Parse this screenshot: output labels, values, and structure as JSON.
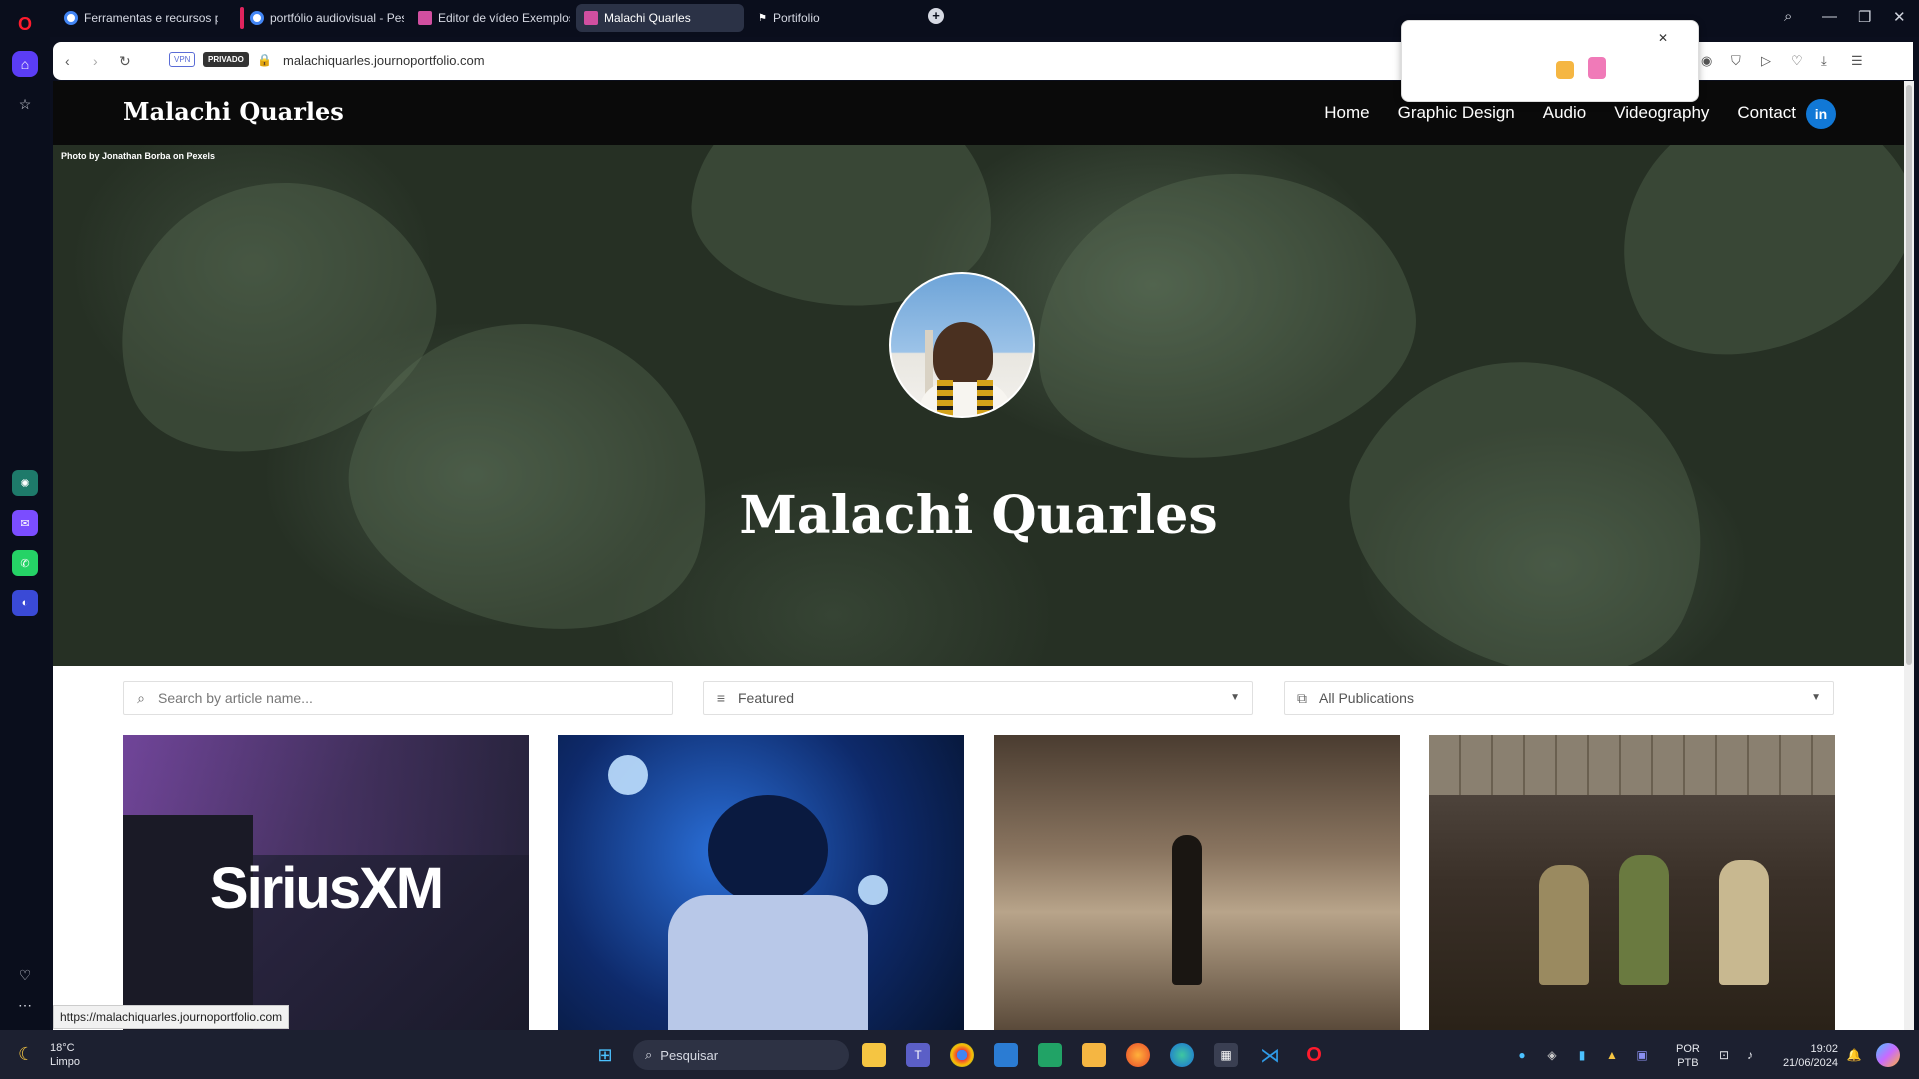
{
  "tabs": [
    {
      "label": "Ferramentas e recursos pa",
      "color": "#4285f4"
    },
    {
      "label": "portfólio audiovisual - Pes",
      "color": "#4285f4"
    },
    {
      "label": "Editor de vídeo Exemplos",
      "color": "#d14fa0"
    },
    {
      "label": "Malachi Quarles",
      "color": "#d14fa0"
    },
    {
      "label": "Portifolio",
      "color": "#ffffff"
    }
  ],
  "address": {
    "vpn": "VPN",
    "private": "PRIVADO",
    "url": "malachiquarles.journoportfolio.com"
  },
  "site": {
    "brand": "Malachi Quarles",
    "nav": [
      "Home",
      "Graphic Design",
      "Audio",
      "Videography",
      "Contact"
    ],
    "linkedin": "in",
    "photo_credit": "Photo by Jonathan Borba on Pexels",
    "hero_title": "Malachi Quarles"
  },
  "filters": {
    "search_placeholder": "Search by article name...",
    "sort_value": "Featured",
    "publication_value": "All Publications"
  },
  "cards": [
    {
      "name": "SiriusXM",
      "brand_text": "SiriusXM",
      "bg": "#2a2540"
    },
    {
      "name": "singer-stage",
      "brand_text": "",
      "bg": "#0e2a6b"
    },
    {
      "name": "street-walk",
      "brand_text": "",
      "bg": "#6b5845"
    },
    {
      "name": "band-store",
      "brand_text": "",
      "bg": "#3a3028"
    }
  ],
  "status_url": "https://malachiquarles.journoportfolio.com",
  "taskbar": {
    "weather_temp": "18°C",
    "weather_desc": "Limpo",
    "search": "Pesquisar",
    "lang1": "POR",
    "lang2": "PTB",
    "time": "19:02",
    "date": "21/06/2024"
  }
}
